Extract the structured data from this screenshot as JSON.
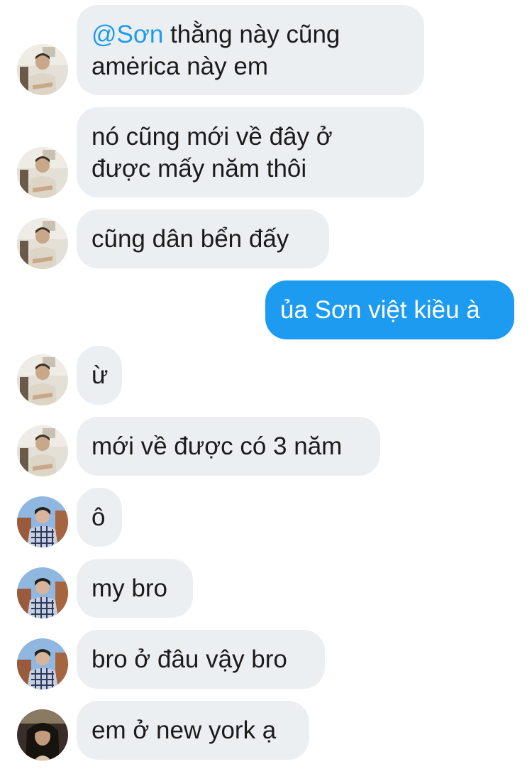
{
  "avatars": {
    "a": {
      "name": "avatar-man-beige-shirt"
    },
    "b": {
      "name": "avatar-man-checkered-shirt"
    },
    "c": {
      "name": "avatar-dark-hair-person"
    }
  },
  "messages": [
    {
      "line1_mention": "@Sơn",
      "line1_rest": " thằng này cũng",
      "line2": "amėrica này em"
    },
    {
      "line1": "nó cũng mới về đây ở",
      "line2": "được mấy năm thôi"
    },
    {
      "text": "cũng dân bển đấy"
    },
    {
      "text": "ủa Sơn việt kiều à"
    },
    {
      "text": "ừ"
    },
    {
      "text": "mới về được có 3 năm"
    },
    {
      "text": "ô"
    },
    {
      "text": "my bro"
    },
    {
      "text": "bro ở đâu vậy bro"
    },
    {
      "text": "em ở new york ạ"
    }
  ],
  "colors": {
    "incoming_bubble": "#eceff1",
    "outgoing_bubble": "#1d9bf0",
    "mention": "#1d9bf0"
  }
}
